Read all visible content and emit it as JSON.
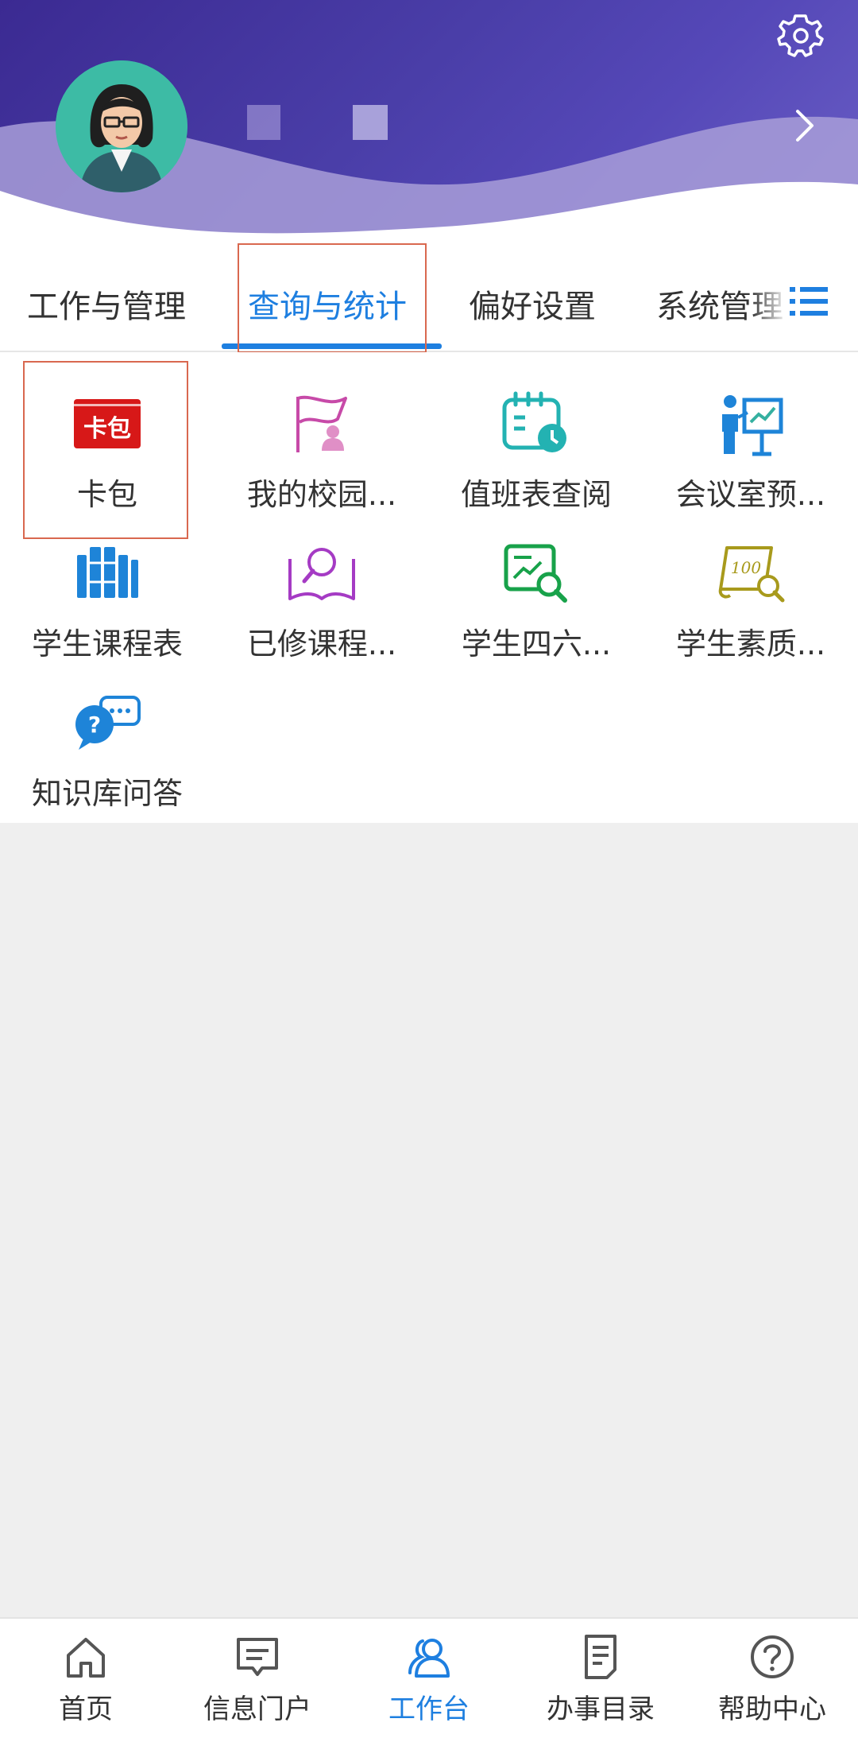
{
  "tabs": [
    {
      "label": "工作与管理",
      "active": false
    },
    {
      "label": "查询与统计",
      "active": true
    },
    {
      "label": "偏好设置",
      "active": false
    },
    {
      "label": "系统管理",
      "active": false
    }
  ],
  "apps": [
    {
      "label": "卡包",
      "icon": "card-wallet-icon",
      "badge_text": "卡包"
    },
    {
      "label": "我的校园...",
      "icon": "campus-flag-icon"
    },
    {
      "label": "值班表查阅",
      "icon": "duty-calendar-icon"
    },
    {
      "label": "会议室预...",
      "icon": "meeting-room-icon"
    },
    {
      "label": "学生课程表",
      "icon": "course-books-icon"
    },
    {
      "label": "已修课程...",
      "icon": "book-search-icon"
    },
    {
      "label": "学生四六...",
      "icon": "cet-search-icon"
    },
    {
      "label": "学生素质...",
      "icon": "score-certificate-icon",
      "badge_text": "100"
    },
    {
      "label": "知识库问答",
      "icon": "qa-chat-icon"
    }
  ],
  "bottom_nav": [
    {
      "label": "首页",
      "icon": "home-icon",
      "active": false
    },
    {
      "label": "信息门户",
      "icon": "message-icon",
      "active": false
    },
    {
      "label": "工作台",
      "icon": "workbench-users-icon",
      "active": true
    },
    {
      "label": "办事目录",
      "icon": "document-list-icon",
      "active": false
    },
    {
      "label": "帮助中心",
      "icon": "help-icon",
      "active": false
    }
  ],
  "colors": {
    "accent": "#1e7fe0",
    "highlight_box": "#d9684f",
    "header": "#3b2a92"
  }
}
